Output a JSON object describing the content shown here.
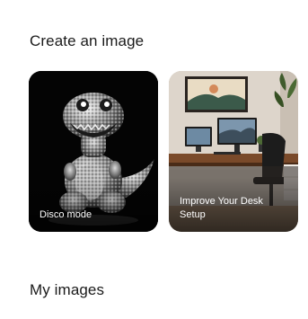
{
  "create_section": {
    "title": "Create an image",
    "cards": [
      {
        "label": "Disco mode"
      },
      {
        "label": "Improve Your Desk Setup"
      }
    ]
  },
  "my_images": {
    "title": "My images"
  }
}
